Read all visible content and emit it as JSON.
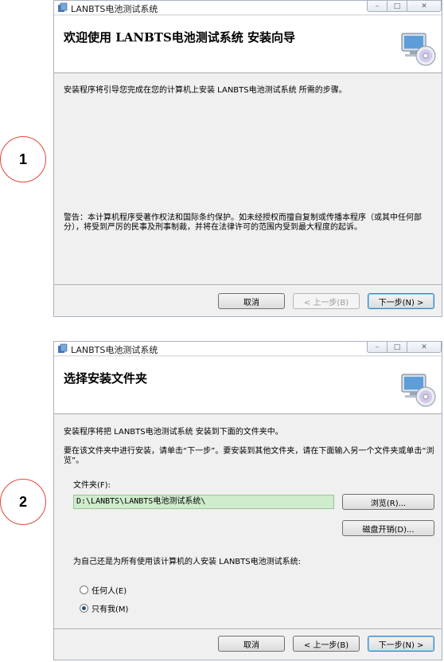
{
  "step1": {
    "badge": "1",
    "window_title": "LANBTS电池测试系统",
    "header_title": "欢迎使用 LANBTS电池测试系统 安装向导",
    "intro": "安装程序将引导您完成在您的计算机上安装 LANBTS电池测试系统 所需的步骤。",
    "warning": "警告：本计算机程序受著作权法和国际条约保护。如未经授权而擅自复制或传播本程序（或其中任何部分），将受到严厉的民事及刑事制裁，并将在法律许可的范围内受到最大程度的起诉。",
    "buttons": {
      "cancel": "取消",
      "back": "< 上一步(B)",
      "next": "下一步(N) >"
    }
  },
  "step2": {
    "badge": "2",
    "window_title": "LANBTS电池测试系统",
    "header_title": "选择安装文件夹",
    "intro": "安装程序将把 LANBTS电池测试系统 安装到下面的文件夹中。",
    "instructions": "要在该文件夹中进行安装，请单击“下一步”。要安装到其他文件夹，请在下面输入另一个文件夹或单击“浏览”。",
    "folder_label": "文件夹(F):",
    "folder_value": "D:\\LANBTS\\LANBTS电池测试系统\\",
    "browse_button": "浏览(R)...",
    "disk_cost_button": "磁盘开销(D)...",
    "install_for_question": "为自己还是为所有使用该计算机的人安装 LANBTS电池测试系统:",
    "radio_everyone": "任何人(E)",
    "radio_just_me": "只有我(M)",
    "selected_option": "just_me",
    "buttons": {
      "cancel": "取消",
      "back": "< 上一步(B)",
      "next": "下一步(N) >"
    }
  },
  "icons": {
    "window_controls": [
      "minimize-icon",
      "maximize-icon",
      "close-icon"
    ],
    "header_graphic": "computer-cd-icon"
  },
  "colors": {
    "circle_border": "#e0473a",
    "folder_field_bg": "#cfeccc",
    "dialog_bg": "#f0f0f0"
  }
}
